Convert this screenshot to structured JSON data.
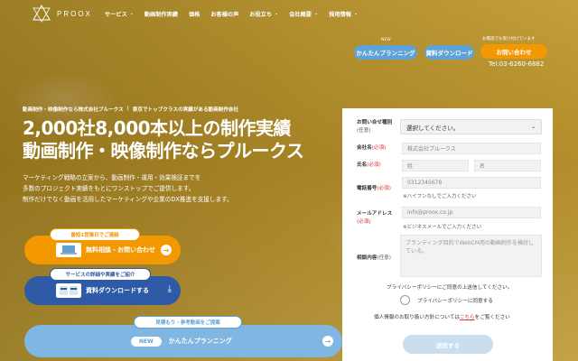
{
  "header": {
    "logo_text": "PROOX",
    "nav": [
      {
        "label": "サービス",
        "has_dropdown": true
      },
      {
        "label": "動画制作実績",
        "has_dropdown": false
      },
      {
        "label": "価格",
        "has_dropdown": false
      },
      {
        "label": "お客様の声",
        "has_dropdown": false
      },
      {
        "label": "お役立ち",
        "has_dropdown": true
      },
      {
        "label": "会社概要",
        "has_dropdown": true
      },
      {
        "label": "採用情報",
        "has_dropdown": true
      }
    ]
  },
  "top_cta": {
    "new_badge": "NEW",
    "plan_label": "かんたんプランニング",
    "doc_label": "資料ダウンロード",
    "daily_note": "お電話でも受け付けています",
    "contact_label": "お問い合わせ",
    "tel": "Tel:03-6260-6882"
  },
  "hero": {
    "subline_left": "動画制作・映像制作なら株式会社プルークス",
    "subline_sep": "|",
    "subline_right": "東京でトップクラスの実績がある動画制作会社",
    "title_line1": "2,000社8,000本以上の制作実績",
    "title_line2": "動画制作・映像制作ならプルークス",
    "desc_line1": "マーケティング戦略の立案から、動画制作・運用・効果検証までを",
    "desc_line2": "多数のプロジェクト実績をもとにワンストップでご提供します。",
    "desc_line3": "制作だけでなく動画を活用したマーケティングや企業のDX推進を支援します。"
  },
  "left_cta": {
    "free_caption": "最短1営業日でご連絡",
    "free_label": "無料相談・お問い合わせ",
    "free_arrow": "→",
    "dl_caption": "サービスの詳細や実績をご紹介",
    "dl_label": "資料ダウンロードする",
    "dl_icon": "⤓",
    "estimate_caption": "見積もり・参考動画をご提案",
    "plan_new": "NEW",
    "plan_label": "かんたんプランニング",
    "plan_arrow": "→"
  },
  "form": {
    "type_label": "お問い合せ種別",
    "type_opt": "(任意)",
    "type_value": "選択してください。",
    "company_label": "会社名",
    "company_req": "(必須)",
    "company_placeholder": "株式会社プルークス",
    "name_label": "氏名",
    "name_req": "(必須)",
    "last_placeholder": "姓",
    "first_placeholder": "名",
    "phone_label": "電話番号",
    "phone_req": "(必須)",
    "phone_placeholder": "0312345678",
    "phone_note": "※ハイフンなしでご入力ください",
    "email_label": "メールアドレス",
    "email_req": "(必須)",
    "email_placeholder": "info@proox.co.jp",
    "email_note": "※ビジネスメールでご入力ください",
    "content_label": "相談内容",
    "content_opt": "(任意)",
    "content_placeholder": "ブランディング目的でWebCM用の動画制作を検討している。",
    "privacy_line": "プライバシーポリシーにご同意の上送信してください。",
    "agree_label": "プライバシーポリシーに同意する",
    "pi_prefix": "個人情報のお取り扱い方針については",
    "pi_link": "こちら",
    "pi_suffix": "をご覧ください",
    "submit_label": "送信する"
  }
}
